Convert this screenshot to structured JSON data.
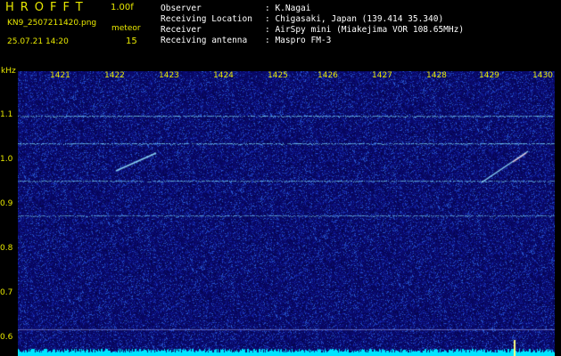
{
  "header": {
    "logo": "HROFFT",
    "version": "1.00f",
    "filename": "KN9_2507211420.png",
    "meteor_label": "meteor",
    "datetime": "25.07.21 14:20",
    "meteor_count": "15",
    "fields": [
      {
        "label": "Observer",
        "value": ": K.Nagai"
      },
      {
        "label": "Receiving Location",
        "value": ": Chigasaki, Japan (139.414 35.340)"
      },
      {
        "label": "Receiver",
        "value": ": AirSpy mini (Miakejima VOR 108.65MHz)"
      },
      {
        "label": "Receiving antenna",
        "value": ": Maspro FM-3"
      }
    ]
  },
  "spectrogram": {
    "y_unit": "kHz",
    "y_ticks": [
      "1.1",
      "1.0",
      "0.9",
      "0.8",
      "0.7",
      "0.6"
    ],
    "x_ticks": [
      "1421",
      "1422",
      "1423",
      "1424",
      "1425",
      "1426",
      "1427",
      "1428",
      "1429",
      "1430"
    ],
    "colors": {
      "background": "#0a0a6e",
      "trace": "#7fe0ff",
      "baseline": "#00e5ff"
    }
  }
}
